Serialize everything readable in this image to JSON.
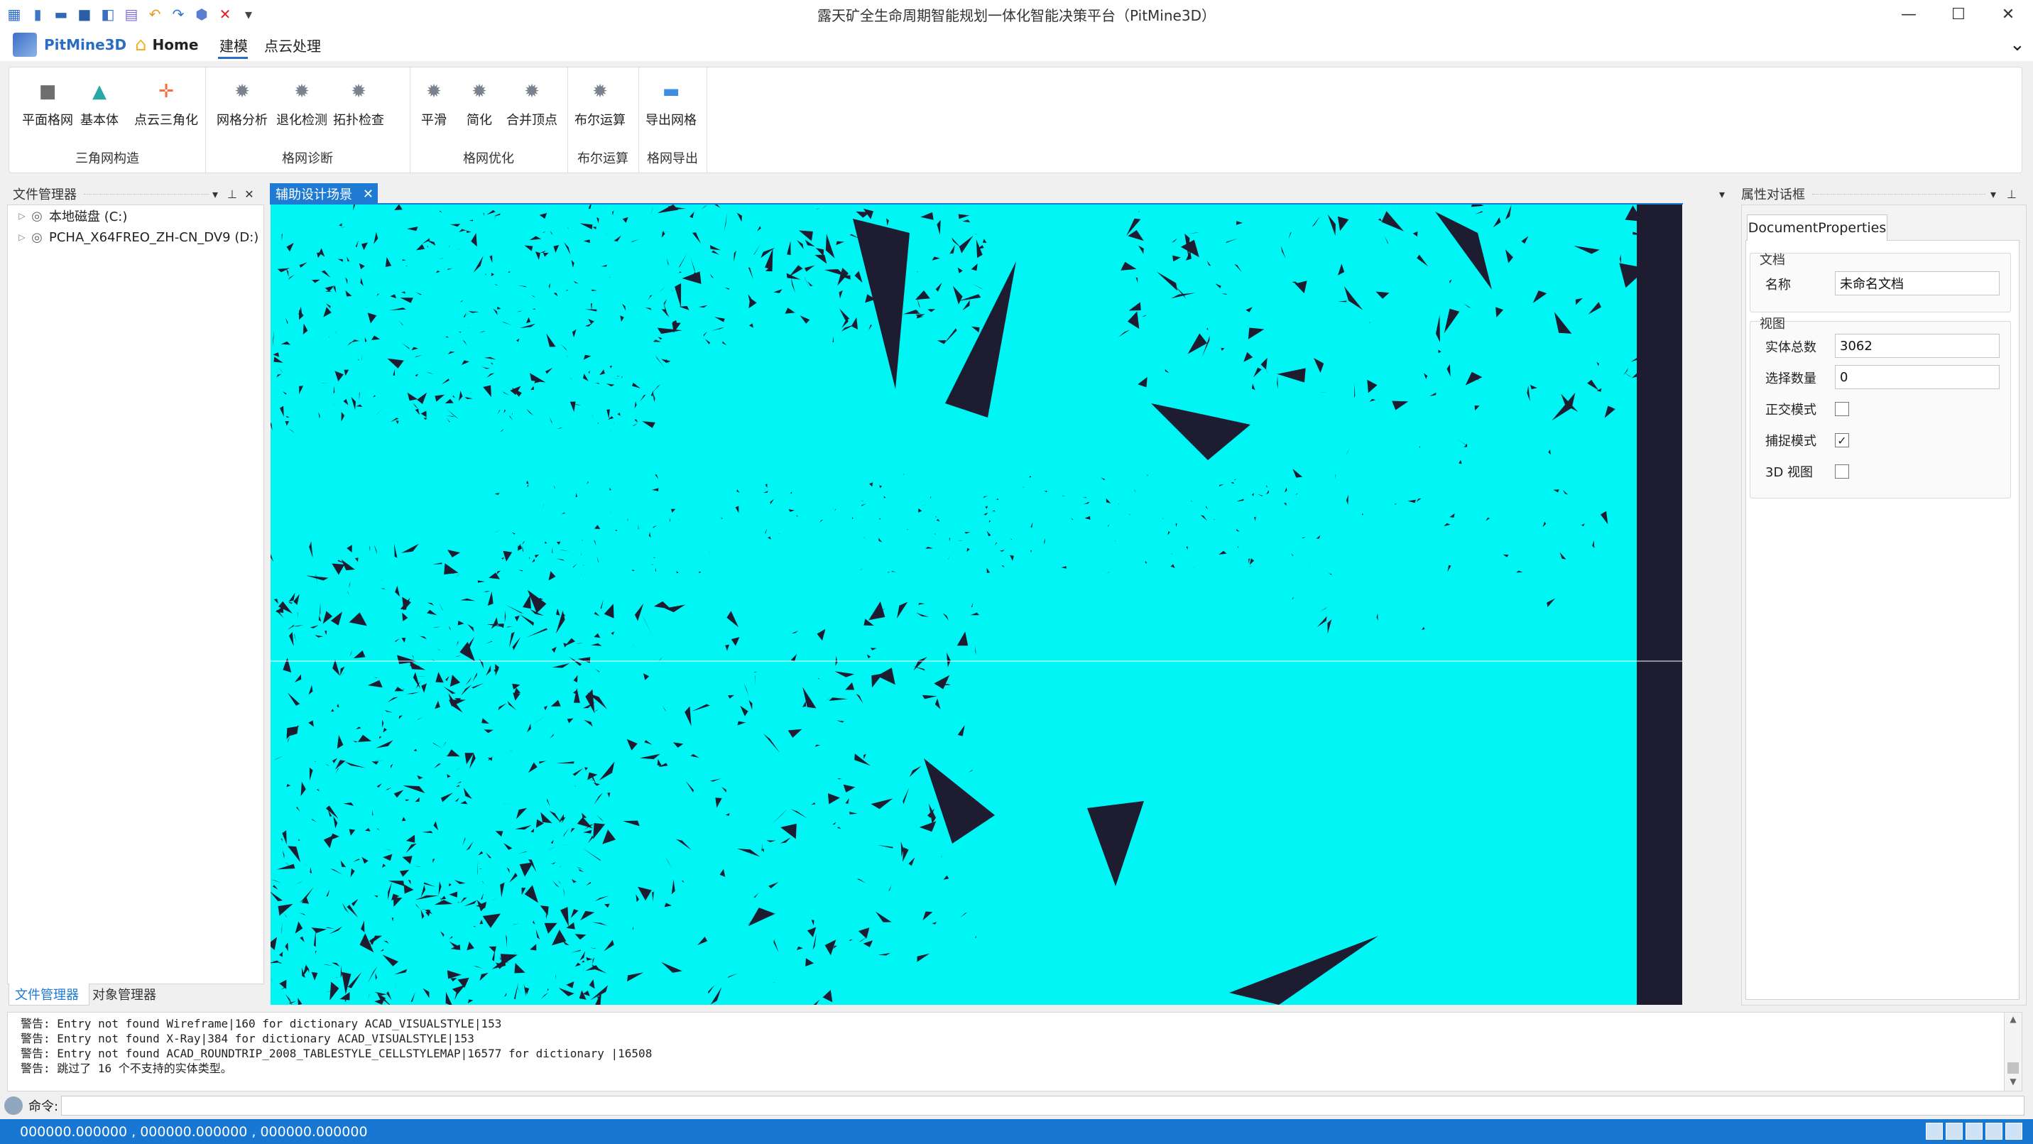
{
  "window": {
    "title": "露天矿全生命周期智能规划一体化智能决策平台（PitMine3D）",
    "min_glyph": "—",
    "max_glyph": "☐",
    "close_glyph": "✕"
  },
  "quick_access": [
    {
      "name": "app-icon",
      "glyph": "▦",
      "color": "#2b6cc4"
    },
    {
      "name": "new-file-icon",
      "glyph": "▮",
      "color": "#3b79c8"
    },
    {
      "name": "open-folder-icon",
      "glyph": "▬",
      "color": "#2f66b8"
    },
    {
      "name": "save-icon",
      "glyph": "■",
      "color": "#2a5ea9"
    },
    {
      "name": "save-as-icon",
      "glyph": "◧",
      "color": "#3a6fc2"
    },
    {
      "name": "print-icon",
      "glyph": "▤",
      "color": "#7a6bd6"
    },
    {
      "name": "undo-icon",
      "glyph": "↶",
      "color": "#e39a1a"
    },
    {
      "name": "redo-icon",
      "glyph": "↷",
      "color": "#2e73c8"
    },
    {
      "name": "cube-icon",
      "glyph": "⬢",
      "color": "#5a7fd0"
    },
    {
      "name": "delete-icon",
      "glyph": "✕",
      "color": "#e02020"
    },
    {
      "name": "quick-access-dropdown-icon",
      "glyph": "▾",
      "color": "#444444"
    }
  ],
  "menu": {
    "brand": "PitMine3D",
    "home": "Home",
    "tab_modeling": "建模",
    "tab_pointcloud": "点云处理",
    "collapse_glyph": "⌄"
  },
  "ribbon": {
    "groups": [
      {
        "title": "三角网构造",
        "buttons": [
          {
            "label": "平面格网",
            "glyph": "■",
            "color": "#6e6e6e"
          },
          {
            "label": "基本体",
            "glyph": "▲",
            "color": "#2aa6a6"
          },
          {
            "label": "点云三角化",
            "glyph": "✛",
            "color": "#ff6a3d"
          }
        ]
      },
      {
        "title": "格网诊断",
        "buttons": [
          {
            "label": "网格分析",
            "glyph": "✹",
            "color": "#7a8290"
          },
          {
            "label": "退化检测",
            "glyph": "✹",
            "color": "#7a8290"
          },
          {
            "label": "拓扑检查",
            "glyph": "✹",
            "color": "#7a8290"
          }
        ]
      },
      {
        "title": "格网优化",
        "buttons": [
          {
            "label": "平滑",
            "glyph": "✹",
            "color": "#7a8290"
          },
          {
            "label": "简化",
            "glyph": "✹",
            "color": "#7a8290"
          },
          {
            "label": "合并顶点",
            "glyph": "✹",
            "color": "#7a8290"
          }
        ]
      },
      {
        "title": "布尔运算",
        "buttons": [
          {
            "label": "布尔运算",
            "glyph": "✹",
            "color": "#7a8290"
          }
        ]
      },
      {
        "title": "格网导出",
        "buttons": [
          {
            "label": "导出网格",
            "glyph": "▬",
            "color": "#3b8fe0"
          }
        ]
      }
    ]
  },
  "file_manager": {
    "title": "文件管理器",
    "dropdown_glyph": "▾",
    "pin_glyph": "⊥",
    "close_glyph": "✕",
    "tree": [
      {
        "label": "本地磁盘 (C:)"
      },
      {
        "label": "PCHA_X64FREO_ZH-CN_DV9 (D:)"
      }
    ],
    "expand_glyph": "▷",
    "drive_glyph": "◎",
    "bottom_tabs": [
      "文件管理器",
      "对象管理器"
    ]
  },
  "scene": {
    "tab_label": "辅助设计场景",
    "tab_close": "✕",
    "menu_glyph": "▾",
    "background_color": "#00f5f5",
    "mesh_color": "#1d1c30"
  },
  "properties": {
    "title": "属性对话框",
    "tab": "DocumentProperties",
    "section_doc": "文档",
    "name_label": "名称",
    "name_value": "未命名文档",
    "section_view": "视图",
    "entity_count_label": "实体总数",
    "entity_count_value": "3062",
    "selected_label": "选择数量",
    "selected_value": "0",
    "ortho_label": "正交模式",
    "snap_label": "捕捉模式",
    "view3d_label": "3D 视图",
    "ortho_checked": false,
    "snap_checked": true,
    "view3d_checked": false,
    "check_glyph": "✓"
  },
  "output": {
    "lines": [
      "警告: Entry not found Wireframe|160 for dictionary ACAD_VISUALSTYLE|153",
      "警告: Entry not found X-Ray|384 for dictionary ACAD_VISUALSTYLE|153",
      "警告: Entry not found ACAD_ROUNDTRIP_2008_TABLESTYLE_CELLSTYLEMAP|16577 for dictionary |16508",
      "警告: 跳过了 16 个不支持的实体类型。"
    ]
  },
  "command": {
    "label": "命令:",
    "value": ""
  },
  "status": {
    "coords": "000000.000000 , 000000.000000 , 000000.000000"
  }
}
